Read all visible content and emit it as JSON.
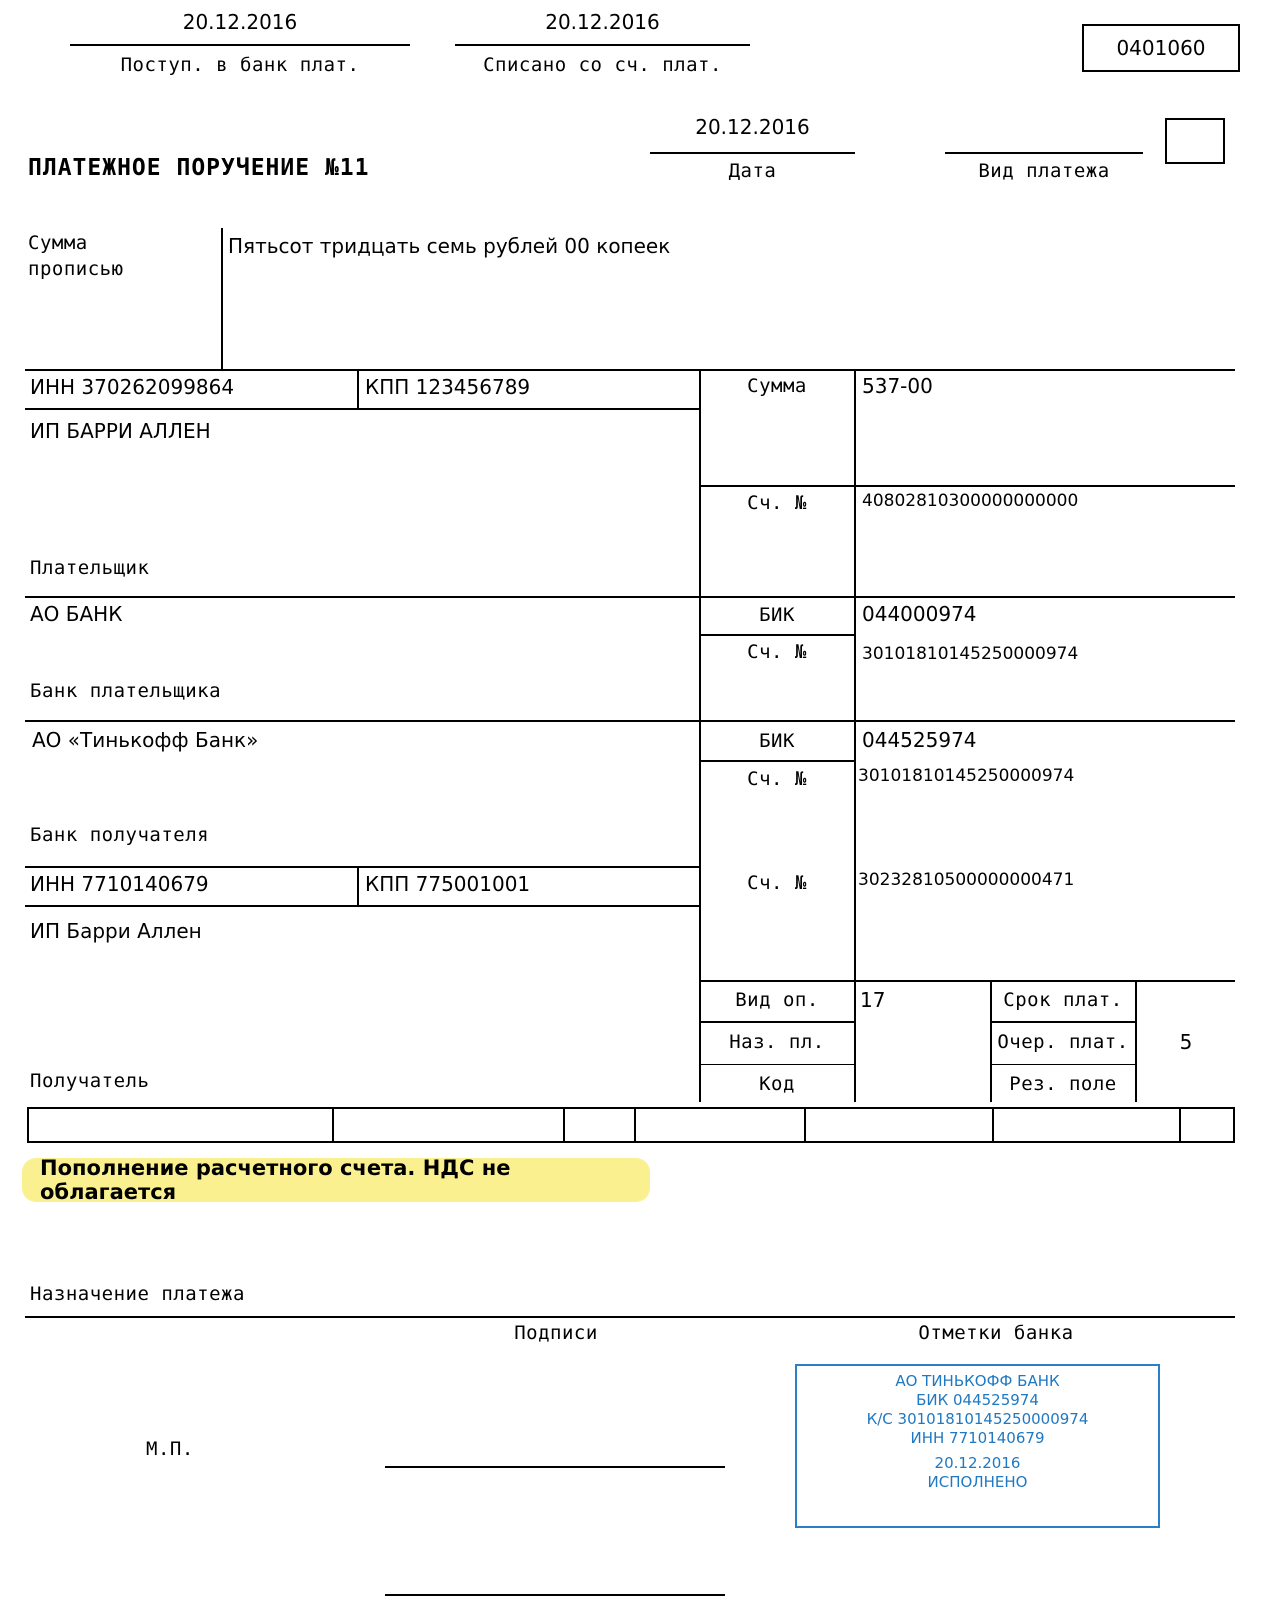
{
  "form": {
    "code_box": "0401060",
    "title": "ПЛАТЕЖНОЕ ПОРУЧЕНИЕ №11",
    "received_date": "20.12.2016",
    "received_label": "Поступ. в банк плат.",
    "debited_date": "20.12.2016",
    "debited_label": "Списано со сч. плат.",
    "doc_date": "20.12.2016",
    "date_label": "Дата",
    "payment_kind_label": "Вид платежа",
    "payment_kind_value": ""
  },
  "amount_words": {
    "label_line1": "Сумма",
    "label_line2": "прописью",
    "value": "Пятьсот тридцать семь рублей 00 копеек"
  },
  "payer": {
    "inn": "ИНН 370262099864",
    "kpp": "КПП 123456789",
    "name": "ИП БАРРИ АЛЛЕН",
    "label": "Плательщик",
    "amount_label": "Сумма",
    "amount_value": "537-00",
    "account_label": "Сч. №",
    "account_value": "40802810300000000000"
  },
  "payer_bank": {
    "name": "АО БАНК",
    "label": "Банк плательщика",
    "bik_label": "БИК",
    "bik_value": "044000974",
    "account_label": "Сч. №",
    "account_value": "30101810145250000974"
  },
  "payee_bank": {
    "name": "АО «Тинькофф Банк»",
    "label": "Банк получателя",
    "bik_label": "БИК",
    "bik_value": "044525974",
    "account_label": "Сч. №",
    "account_value": "30101810145250000974"
  },
  "payee": {
    "inn": "ИНН 7710140679",
    "kpp": "КПП 775001001",
    "name": "ИП Барри Аллен",
    "label": "Получатель",
    "account_label": "Сч. №",
    "account_value": "30232810500000000471"
  },
  "ops": {
    "vid_op_label": "Вид оп.",
    "vid_op_value": "17",
    "naz_pl_label": "Наз. пл.",
    "naz_pl_value": "",
    "kod_label": "Код",
    "kod_value": "",
    "srok_plat_label": "Срок плат.",
    "srok_plat_value": "",
    "ocher_plat_label": "Очер. плат.",
    "ocher_plat_value": "5",
    "rez_pole_label": "Рез. поле",
    "rez_pole_value": ""
  },
  "budget_row": [
    "",
    "",
    "",
    "",
    "",
    "",
    "",
    ""
  ],
  "purpose": {
    "highlight_text": "Пополнение расчетного счета. НДС не облагается",
    "label": "Назначение платежа"
  },
  "footer": {
    "signatures_label": "Подписи",
    "bank_marks_label": "Отметки банка",
    "stamp_label": "М.П."
  },
  "bank_stamp": {
    "line1": "АО ТИНЬКОФФ БАНК",
    "line2": "БИК 044525974",
    "line3": "К/С 30101810145250000974",
    "line4": "ИНН 7710140679",
    "line5": "20.12.2016",
    "line6": "ИСПОЛНЕНО"
  },
  "colors": {
    "stamp_blue": "#1f78c1",
    "highlight_yellow": "#faf08f"
  }
}
